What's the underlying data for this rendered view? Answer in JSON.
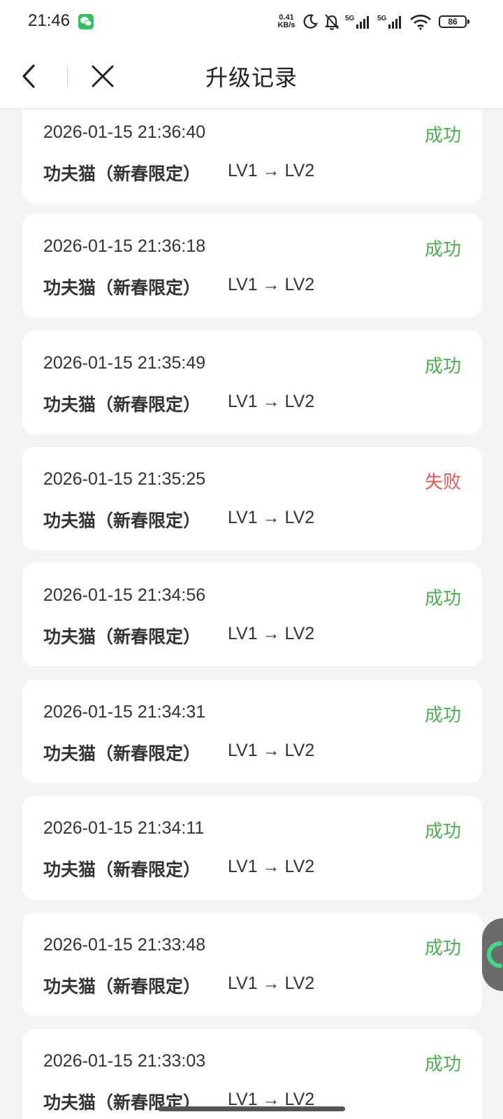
{
  "status_bar": {
    "time": "21:46",
    "net_speed_value": "0.41",
    "net_speed_unit": "KB/s",
    "battery": "86",
    "icons": [
      "wechat-icon",
      "moon-icon",
      "bell-off-icon",
      "signal-5g-icon",
      "signal-5g-icon",
      "wifi-icon",
      "battery-icon"
    ]
  },
  "nav": {
    "title": "升级记录",
    "back_icon": "back-arrow-icon",
    "close_icon": "close-icon"
  },
  "colors": {
    "success": "#4caf50",
    "failure": "#e05a55"
  },
  "records": [
    {
      "time": "2026-01-15 21:36:40",
      "status": "成功",
      "item": "功夫猫（新春限定）",
      "level": "LV1 → LV2"
    },
    {
      "time": "2026-01-15 21:36:18",
      "status": "成功",
      "item": "功夫猫（新春限定）",
      "level": "LV1 → LV2"
    },
    {
      "time": "2026-01-15 21:35:49",
      "status": "成功",
      "item": "功夫猫（新春限定）",
      "level": "LV1 → LV2"
    },
    {
      "time": "2026-01-15 21:35:25",
      "status": "失败",
      "item": "功夫猫（新春限定）",
      "level": "LV1 → LV2"
    },
    {
      "time": "2026-01-15 21:34:56",
      "status": "成功",
      "item": "功夫猫（新春限定）",
      "level": "LV1 → LV2"
    },
    {
      "time": "2026-01-15 21:34:31",
      "status": "成功",
      "item": "功夫猫（新春限定）",
      "level": "LV1 → LV2"
    },
    {
      "time": "2026-01-15 21:34:11",
      "status": "成功",
      "item": "功夫猫（新春限定）",
      "level": "LV1 → LV2"
    },
    {
      "time": "2026-01-15 21:33:48",
      "status": "成功",
      "item": "功夫猫（新春限定）",
      "level": "LV1 → LV2"
    },
    {
      "time": "2026-01-15 21:33:03",
      "status": "成功",
      "item": "功夫猫（新春限定）",
      "level": "LV1 → LV2"
    }
  ]
}
